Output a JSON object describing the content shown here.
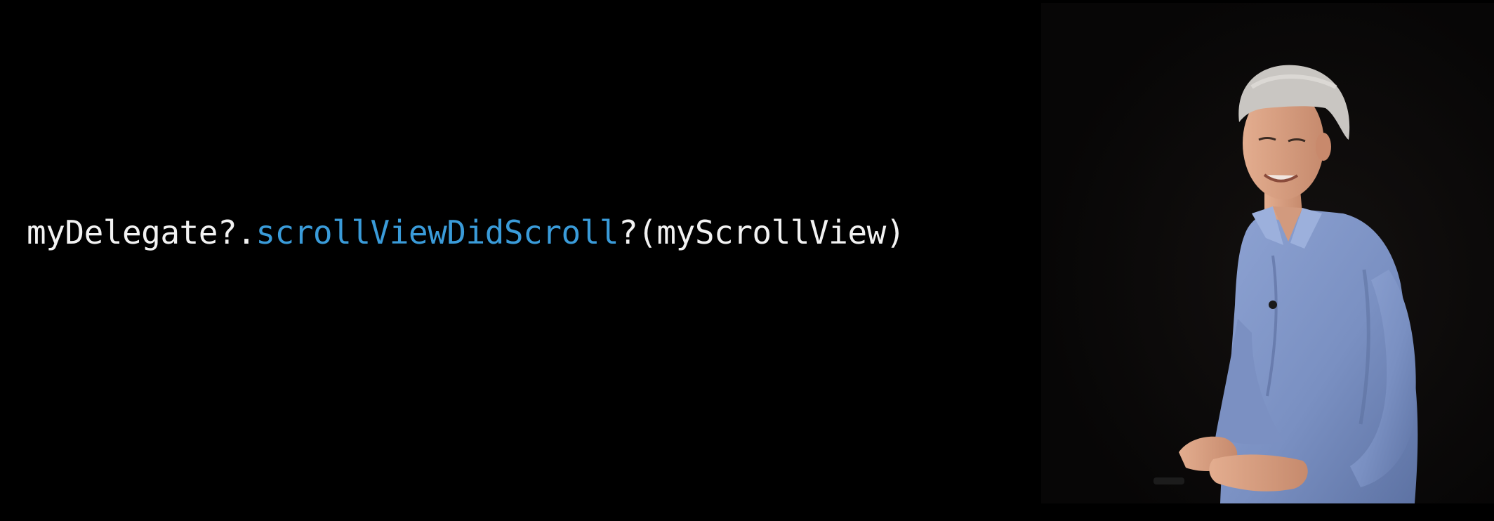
{
  "slide": {
    "code": {
      "receiver": "myDelegate?.",
      "method": "scrollViewDidScroll",
      "args": "?(myScrollView)"
    },
    "colors": {
      "background": "#000000",
      "code_text": "#f2f2f2",
      "method_highlight": "#3a9bd9"
    }
  },
  "presenter": {
    "depiction": "presenter-photo",
    "colors": {
      "shirt": "#7f95c6",
      "hair": "#c9c6c2",
      "skin": "#d9a184"
    }
  }
}
